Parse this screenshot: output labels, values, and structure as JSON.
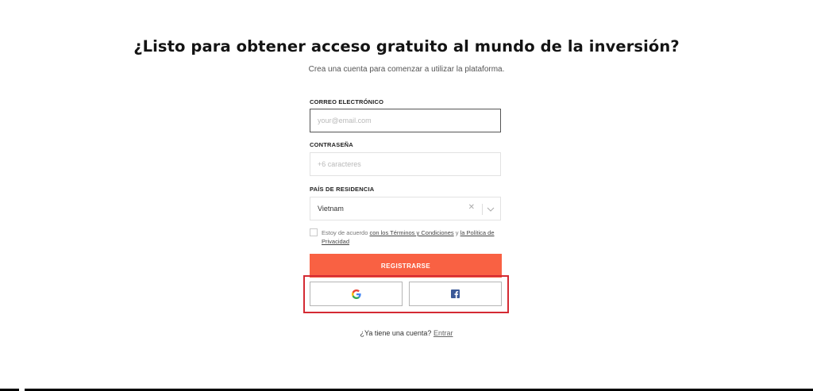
{
  "header": {
    "title": "¿Listo para obtener acceso gratuito al mundo de la inversión?",
    "subtitle": "Crea una cuenta para comenzar a utilizar la plataforma."
  },
  "form": {
    "email": {
      "label": "CORREO ELECTRÓNICO",
      "placeholder": "your@email.com",
      "value": ""
    },
    "password": {
      "label": "CONTRASEÑA",
      "placeholder": "+6 caracteres",
      "value": ""
    },
    "country": {
      "label": "PAÍS DE RESIDENCIA",
      "value": "Vietnam"
    },
    "terms": {
      "prefix": "Estoy de acuerdo ",
      "terms_link": "con los Términos y Condiciones",
      "middle": " y ",
      "privacy_link": "la Política de Privacidad",
      "checked": false
    },
    "register_label": "REGISTRARSE"
  },
  "social": {
    "google_icon": "google-icon",
    "facebook_icon": "facebook-icon"
  },
  "footer": {
    "question": "¿Ya tiene una cuenta? ",
    "login_link": "Entrar"
  },
  "colors": {
    "accent": "#f96143",
    "highlight": "#d42a33",
    "facebook": "#3b5998"
  }
}
